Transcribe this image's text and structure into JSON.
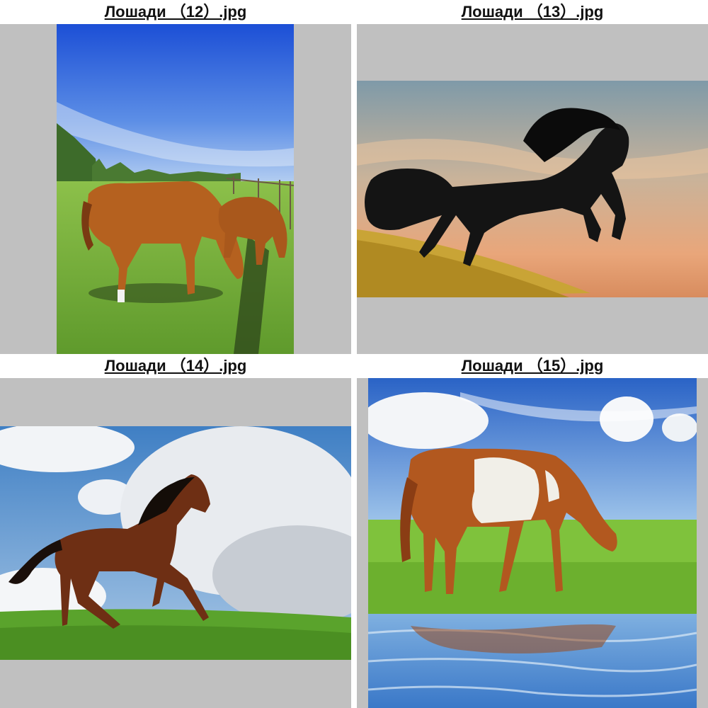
{
  "thumbnails": [
    {
      "filename": "Лошади （12）.jpg",
      "subject": "two chestnut horses grazing in a fenced pasture under blue sky",
      "icon": "image-thumbnail"
    },
    {
      "filename": "Лошади （13）.jpg",
      "subject": "black horse rearing on golden grass at sunset",
      "icon": "image-thumbnail"
    },
    {
      "filename": "Лошади （14）.jpg",
      "subject": "bay horse galloping on green meadow under cloudy sky",
      "icon": "image-thumbnail"
    },
    {
      "filename": "Лошади （15）.jpg",
      "subject": "paint horse grazing by water with reflection",
      "icon": "image-thumbnail"
    }
  ],
  "colors": {
    "frame_background": "#c0c0c0",
    "caption_text": "#111111",
    "page_background": "#ffffff"
  }
}
